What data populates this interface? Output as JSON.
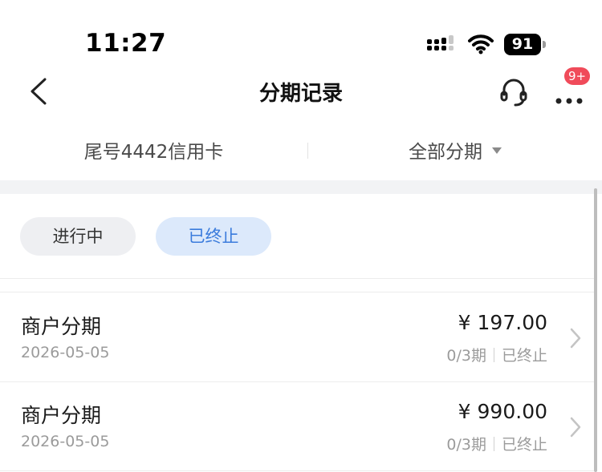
{
  "status_bar": {
    "time": "11:27",
    "battery": "91"
  },
  "nav": {
    "title": "分期记录",
    "badge": "9+"
  },
  "filters": {
    "card": "尾号4442信用卡",
    "type": "全部分期"
  },
  "tabs": [
    {
      "label": "进行中",
      "active": false
    },
    {
      "label": "已终止",
      "active": true
    }
  ],
  "records": [
    {
      "title": "商户分期",
      "date": "2026-05-05",
      "amount": "¥ 197.00",
      "periods": "0/3期",
      "status": "已终止"
    },
    {
      "title": "商户分期",
      "date": "2026-05-05",
      "amount": "¥ 990.00",
      "periods": "0/3期",
      "status": "已终止"
    }
  ],
  "colors": {
    "accent": "#3a7bdc",
    "badge": "#f04b5a",
    "band": "#f2f3f5"
  }
}
